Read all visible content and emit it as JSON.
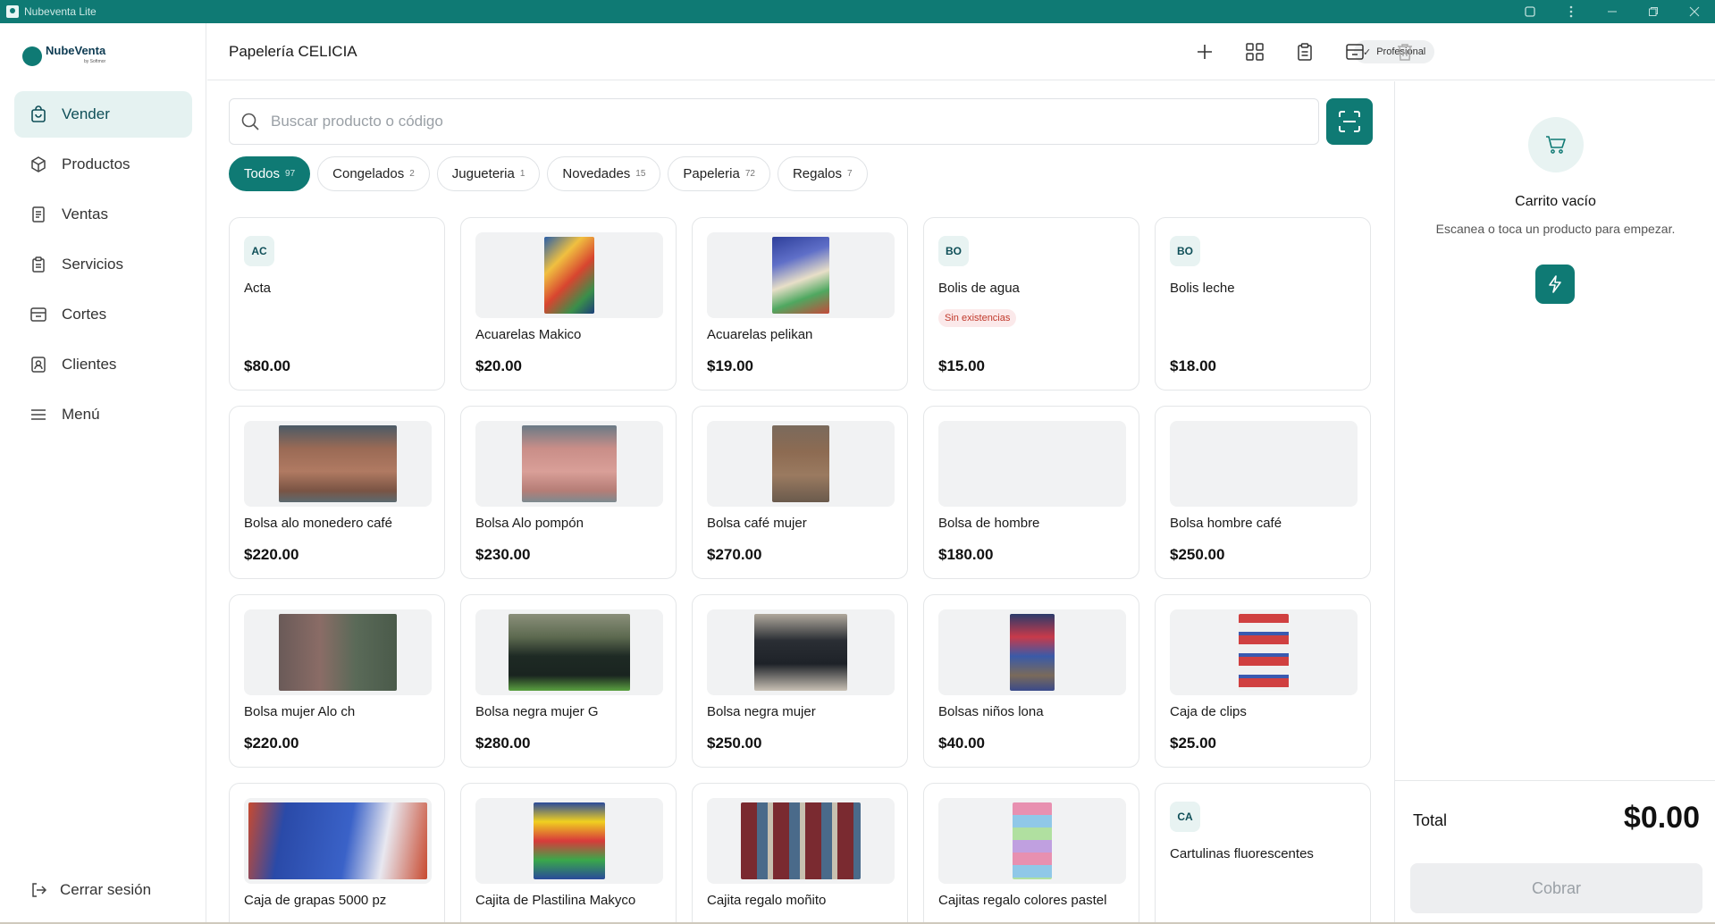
{
  "window": {
    "title": "Nubeventa Lite"
  },
  "brand": {
    "name": "NubeVenta",
    "sub": "by Softmor"
  },
  "sidebar": {
    "items": [
      {
        "label": "Vender",
        "icon": "shopping-bag-icon",
        "active": true
      },
      {
        "label": "Productos",
        "icon": "box-icon",
        "active": false
      },
      {
        "label": "Ventas",
        "icon": "receipt-icon",
        "active": false
      },
      {
        "label": "Servicios",
        "icon": "clipboard-icon",
        "active": false
      },
      {
        "label": "Cortes",
        "icon": "drawer-icon",
        "active": false
      },
      {
        "label": "Clientes",
        "icon": "contact-icon",
        "active": false
      },
      {
        "label": "Menú",
        "icon": "menu-icon",
        "active": false
      }
    ],
    "logout_label": "Cerrar sesión"
  },
  "header": {
    "store_name": "Papelería CELICIA",
    "plan_badge": "Profesional"
  },
  "search": {
    "placeholder": "Buscar producto o código",
    "value": ""
  },
  "categories": [
    {
      "label": "Todos",
      "count": "97",
      "active": true
    },
    {
      "label": "Congelados",
      "count": "2",
      "active": false
    },
    {
      "label": "Jugueteria",
      "count": "1",
      "active": false
    },
    {
      "label": "Novedades",
      "count": "15",
      "active": false
    },
    {
      "label": "Papeleria",
      "count": "72",
      "active": false
    },
    {
      "label": "Regalos",
      "count": "7",
      "active": false
    }
  ],
  "products": [
    {
      "name": "Acta",
      "price": "$80.00",
      "initials": "AC"
    },
    {
      "name": "Acuarelas Makico",
      "price": "$20.00",
      "image": "watercolor-set"
    },
    {
      "name": "Acuarelas pelikan",
      "price": "$19.00",
      "image": "watercolor-set"
    },
    {
      "name": "Bolis de agua",
      "price": "$15.00",
      "initials": "BO",
      "badge": "Sin existencias"
    },
    {
      "name": "Bolis leche",
      "price": "$18.00",
      "initials": "BO"
    },
    {
      "name": "Bolsa alo monedero café",
      "price": "$220.00",
      "image": "brown-bag"
    },
    {
      "name": "Bolsa Alo pompón",
      "price": "$230.00",
      "image": "pink-bag"
    },
    {
      "name": "Bolsa café mujer",
      "price": "$270.00",
      "image": "brown-bag"
    },
    {
      "name": "Bolsa de hombre",
      "price": "$180.00",
      "image": "empty"
    },
    {
      "name": "Bolsa hombre café",
      "price": "$250.00",
      "image": "empty"
    },
    {
      "name": "Bolsa mujer Alo ch",
      "price": "$220.00",
      "image": "backpacks"
    },
    {
      "name": "Bolsa negra mujer G",
      "price": "$280.00",
      "image": "black-bag"
    },
    {
      "name": "Bolsa negra mujer",
      "price": "$250.00",
      "image": "black-bag"
    },
    {
      "name": "Bolsas niños lona",
      "price": "$40.00",
      "image": "kids-bags"
    },
    {
      "name": "Caja de clips",
      "price": "$25.00",
      "image": "clips-box"
    },
    {
      "name": "Caja de grapas 5000 pz",
      "price": "",
      "image": "staples-box"
    },
    {
      "name": "Cajita de Plastilina Makyco",
      "price": "",
      "image": "plasticine-box"
    },
    {
      "name": "Cajita regalo moñito",
      "price": "",
      "image": "gift-boxes"
    },
    {
      "name": "Cajitas regalo colores pastel",
      "price": "",
      "image": "pastel-boxes"
    },
    {
      "name": "Cartulinas fluorescentes",
      "price": "",
      "initials": "CA"
    }
  ],
  "cart": {
    "empty_title": "Carrito vacío",
    "empty_subtitle": "Escanea o toca un producto para empezar.",
    "total_label": "Total",
    "total_value": "$0.00",
    "charge_label": "Cobrar"
  },
  "colors": {
    "accent": "#0f7a74",
    "accent_light": "#e5f2f1",
    "danger_bg": "#fbe9ea",
    "danger_text": "#c0392b"
  }
}
